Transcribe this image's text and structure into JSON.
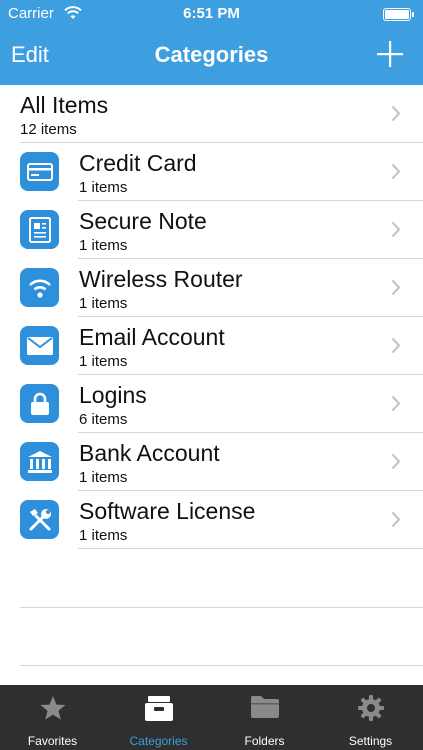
{
  "status_bar": {
    "carrier": "Carrier",
    "time": "6:51 PM"
  },
  "nav": {
    "edit_label": "Edit",
    "title": "Categories",
    "add_icon": "plus-icon"
  },
  "all_items": {
    "title": "All Items",
    "count": "12 items"
  },
  "categories": [
    {
      "title": "Credit Card",
      "count": "1 items",
      "icon": "credit-card-icon"
    },
    {
      "title": "Secure Note",
      "count": "1 items",
      "icon": "secure-note-icon"
    },
    {
      "title": "Wireless Router",
      "count": "1 items",
      "icon": "wifi-icon"
    },
    {
      "title": "Email Account",
      "count": "1 items",
      "icon": "envelope-icon"
    },
    {
      "title": "Logins",
      "count": "6 items",
      "icon": "lock-icon"
    },
    {
      "title": "Bank Account",
      "count": "1 items",
      "icon": "bank-icon"
    },
    {
      "title": "Software License",
      "count": "1 items",
      "icon": "tools-icon"
    }
  ],
  "tabs": [
    {
      "label": "Favorites",
      "icon": "star-icon",
      "active": false
    },
    {
      "label": "Categories",
      "icon": "file-box-icon",
      "active": true
    },
    {
      "label": "Folders",
      "icon": "folder-icon",
      "active": false
    },
    {
      "label": "Settings",
      "icon": "gear-icon",
      "active": false
    }
  ],
  "colors": {
    "accent": "#3d9ee0",
    "icon_bg": "#2e8fdb",
    "tabbar_bg": "#2f2f2f"
  }
}
